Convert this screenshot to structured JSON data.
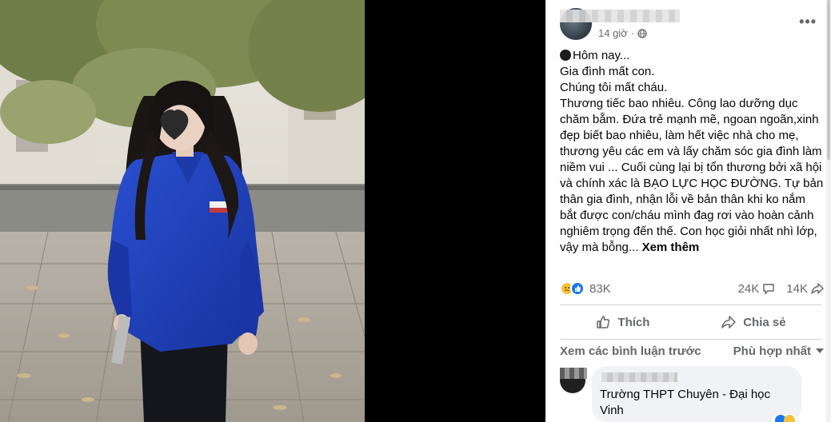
{
  "post": {
    "author_name": "",
    "time": "14 giờ",
    "lines": [
      "Hôm nay...",
      "Gia đình mất con.",
      "Chúng tôi mất cháu.",
      "Thương tiếc bao nhiêu. Công lao dưỡng dục",
      "chăm bẵm. Đứa trẻ mạnh mẽ, ngoan ngoãn,xinh",
      "đẹp biết bao nhiêu, làm hết việc nhà cho mẹ,",
      "thương yêu các em và lấy chăm sóc gia đình làm",
      "niềm vui ... Cuối cùng lại bị tổn thương bởi xã hội",
      "và chính xác là BẠO LỰC HỌC ĐƯỜNG. Tự bản",
      "thân gia đình, nhận lỗi về bản thân khi ko nắm",
      "bắt được con/cháu mình đag rơi vào hoàn cảnh",
      "nghiêm trọng đến thế. Con học giỏi nhất nhì lớp,",
      "vậy mà bỗng..."
    ],
    "see_more": "Xem thêm"
  },
  "stats": {
    "reactions": "83K",
    "comments": "24K",
    "shares": "14K"
  },
  "actions": {
    "like": "Thích",
    "share": "Chia sẻ"
  },
  "comments": {
    "view_previous": "Xem các bình luận trước",
    "sort": "Phù hợp nhất",
    "first": {
      "text": "Trường THPT Chuyên - Đại học Vinh"
    }
  },
  "colors": {
    "accent": "#1877f2",
    "muted_text": "#65676b",
    "bubble": "#f0f2f5",
    "shirt": "#1f3fbf"
  }
}
